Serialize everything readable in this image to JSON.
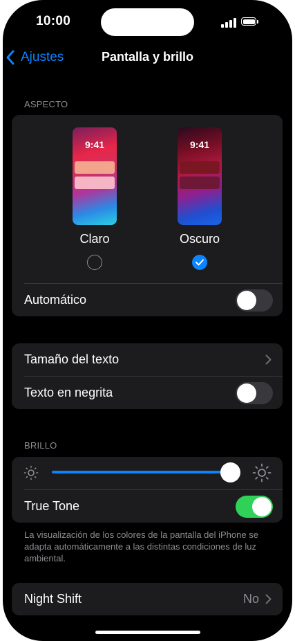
{
  "status_bar": {
    "time": "10:00"
  },
  "nav": {
    "back_label": "Ajustes",
    "title": "Pantalla y brillo"
  },
  "appearance": {
    "section_label": "ASPECTO",
    "light": {
      "thumb_time": "9:41",
      "label": "Claro",
      "selected": false
    },
    "dark": {
      "thumb_time": "9:41",
      "label": "Oscuro",
      "selected": true
    },
    "automatic": {
      "label": "Automático",
      "on": false
    }
  },
  "text_group": {
    "text_size_label": "Tamaño del texto",
    "bold_text": {
      "label": "Texto en negrita",
      "on": false
    }
  },
  "brightness": {
    "section_label": "BRILLO",
    "level": 0.93,
    "true_tone": {
      "label": "True Tone",
      "on": true
    },
    "footnote": "La visualización de los colores de la pantalla del iPhone se adapta automáticamente a las distintas condiciones de luz ambiental."
  },
  "night_shift": {
    "label": "Night Shift",
    "value": "No"
  },
  "colors": {
    "accent": "#0a84ff",
    "toggle_on": "#30d158",
    "background": "#000000",
    "cell": "#1c1c1e"
  },
  "icons": [
    "chevron-left-icon",
    "sun-icon",
    "chevron-right-icon",
    "checkmark-icon",
    "signal-icon",
    "battery-icon"
  ]
}
